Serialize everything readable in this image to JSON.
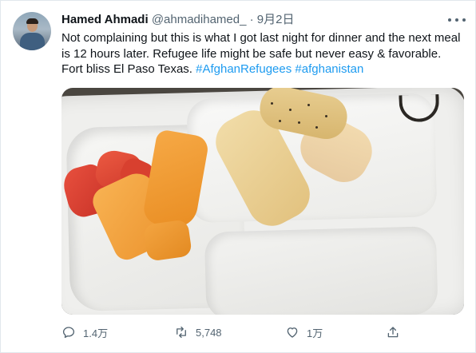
{
  "tweet": {
    "author_name": "Hamed Ahmadi",
    "handle": "@ahmadihamed_",
    "separator": "·",
    "date": "9月2日",
    "text_plain": "Not complaining but this is what I got last night for dinner and the next meal is 12 hours later. Refugee life might be safe but never easy & favorable. Fort bliss El Paso Texas. ",
    "hashtags": [
      "#AfghanRefugees",
      "#afghanistan"
    ]
  },
  "actions": {
    "reply": {
      "icon": "reply-icon",
      "count": "1.4万"
    },
    "retweet": {
      "icon": "retweet-icon",
      "count": "5,748"
    },
    "like": {
      "icon": "like-icon",
      "count": "1万"
    },
    "share": {
      "icon": "share-icon"
    }
  },
  "icons": {
    "more": "more-options-icon"
  },
  "colors": {
    "link": "#1d9bf0",
    "muted": "#536471",
    "text": "#0f1419"
  }
}
